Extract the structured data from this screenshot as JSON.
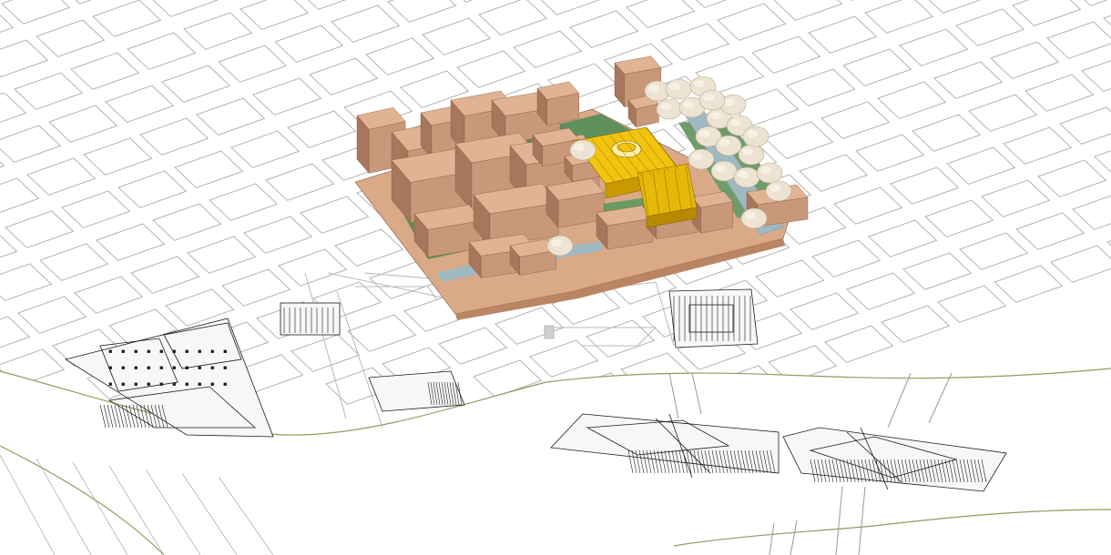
{
  "scene": {
    "kind": "axonometric urban site model",
    "colors": {
      "background": "#ffffff",
      "street_lines": "#b3b3b3",
      "plan_lines": "#1a1a1a",
      "riverbank": "#9c9660",
      "building_light": "#e0b394",
      "building_mid": "#c9987a",
      "building_dark": "#a7765c",
      "lawn": "#5f8f5b",
      "canal": "#9fb9c2",
      "highlight": "#f2c40f",
      "trees": "#ede3d2"
    },
    "elements": [
      {
        "name": "street-grid"
      },
      {
        "name": "riverbank"
      },
      {
        "name": "site-model"
      },
      {
        "name": "highlighted-building"
      },
      {
        "name": "tree-row"
      },
      {
        "name": "floor-plan-left"
      },
      {
        "name": "floor-plan-small"
      },
      {
        "name": "floor-plan-center"
      },
      {
        "name": "floor-plan-right"
      },
      {
        "name": "riverside-plan-1"
      },
      {
        "name": "riverside-plan-2"
      }
    ]
  }
}
